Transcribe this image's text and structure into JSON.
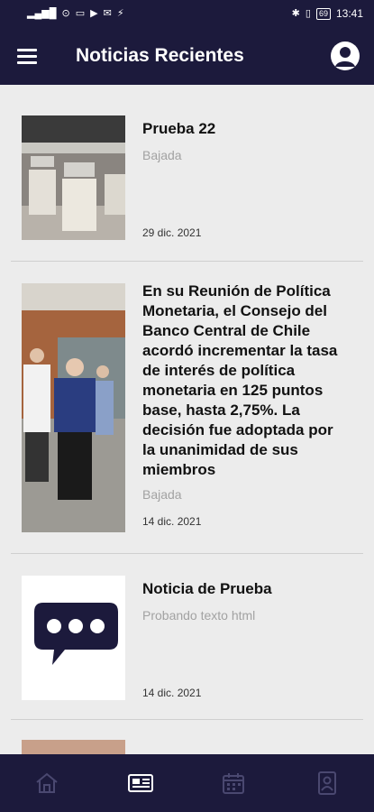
{
  "status_bar": {
    "left_glyphs": [
      "▂▄▆█",
      "⊙",
      "▭",
      "▶",
      "✉",
      "⚡"
    ],
    "battery": "69",
    "time": "13:41"
  },
  "header": {
    "title": "Noticias Recientes",
    "menu_icon": "hamburger-menu-icon",
    "avatar_icon": "user-avatar-icon"
  },
  "news": [
    {
      "title": "Prueba 22",
      "subtitle": "Bajada",
      "date": "29 dic. 2021",
      "image": "museum-display-photo"
    },
    {
      "title": "En su Reunión de Política Monetaria, el Consejo del Banco Central de Chile acordó incrementar la tasa de interés de política monetaria en 125 puntos base, hasta 2,75%. La decisión fue adoptada por la unanimidad de sus miembros",
      "subtitle": "Bajada",
      "date": "14 dic. 2021",
      "image": "people-outdoors-photo"
    },
    {
      "title": "Noticia de Prueba",
      "subtitle": "Probando texto html",
      "date": "14 dic. 2021",
      "image": "chat-bubble-icon"
    }
  ],
  "bottom_nav": [
    {
      "icon": "home-icon"
    },
    {
      "icon": "news-icon"
    },
    {
      "icon": "calendar-icon"
    },
    {
      "icon": "contacts-icon"
    }
  ],
  "colors": {
    "primary": "#1c1a3c",
    "background": "#ececec",
    "muted_text": "#a2a2a2"
  }
}
